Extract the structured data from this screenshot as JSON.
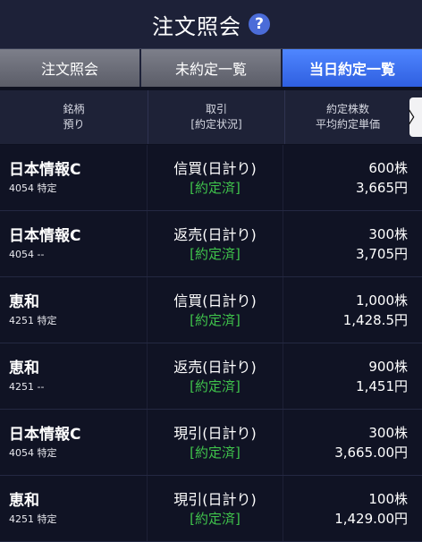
{
  "header": {
    "title": "注文照会",
    "help_icon": "?"
  },
  "tabs": [
    {
      "label": "注文照会",
      "active": false
    },
    {
      "label": "未約定一覧",
      "active": false
    },
    {
      "label": "当日約定一覧",
      "active": true
    }
  ],
  "columns": {
    "c1_line1": "銘柄",
    "c1_line2": "預り",
    "c2_line1": "取引",
    "c2_line2": "[約定状況]",
    "c3_line1": "約定株数",
    "c3_line2": "平均約定単価",
    "more_icon": "〉"
  },
  "rows": [
    {
      "name": "日本情報C",
      "code": "4054 特定",
      "trade": "信買(日計り)",
      "status": "[約定済]",
      "qty": "600株",
      "price": "3,665円"
    },
    {
      "name": "日本情報C",
      "code": "4054 --",
      "trade": "返売(日計り)",
      "status": "[約定済]",
      "qty": "300株",
      "price": "3,705円"
    },
    {
      "name": "恵和",
      "code": "4251 特定",
      "trade": "信買(日計り)",
      "status": "[約定済]",
      "qty": "1,000株",
      "price": "1,428.5円"
    },
    {
      "name": "恵和",
      "code": "4251 --",
      "trade": "返売(日計り)",
      "status": "[約定済]",
      "qty": "900株",
      "price": "1,451円"
    },
    {
      "name": "日本情報C",
      "code": "4054 特定",
      "trade": "現引(日計り)",
      "status": "[約定済]",
      "qty": "300株",
      "price": "3,665.00円"
    },
    {
      "name": "恵和",
      "code": "4251 特定",
      "trade": "現引(日計り)",
      "status": "[約定済]",
      "qty": "100株",
      "price": "1,429.00円"
    }
  ],
  "colors": {
    "accent": "#3b6ef0",
    "status_green": "#3fc24b",
    "background": "#0e1120"
  }
}
